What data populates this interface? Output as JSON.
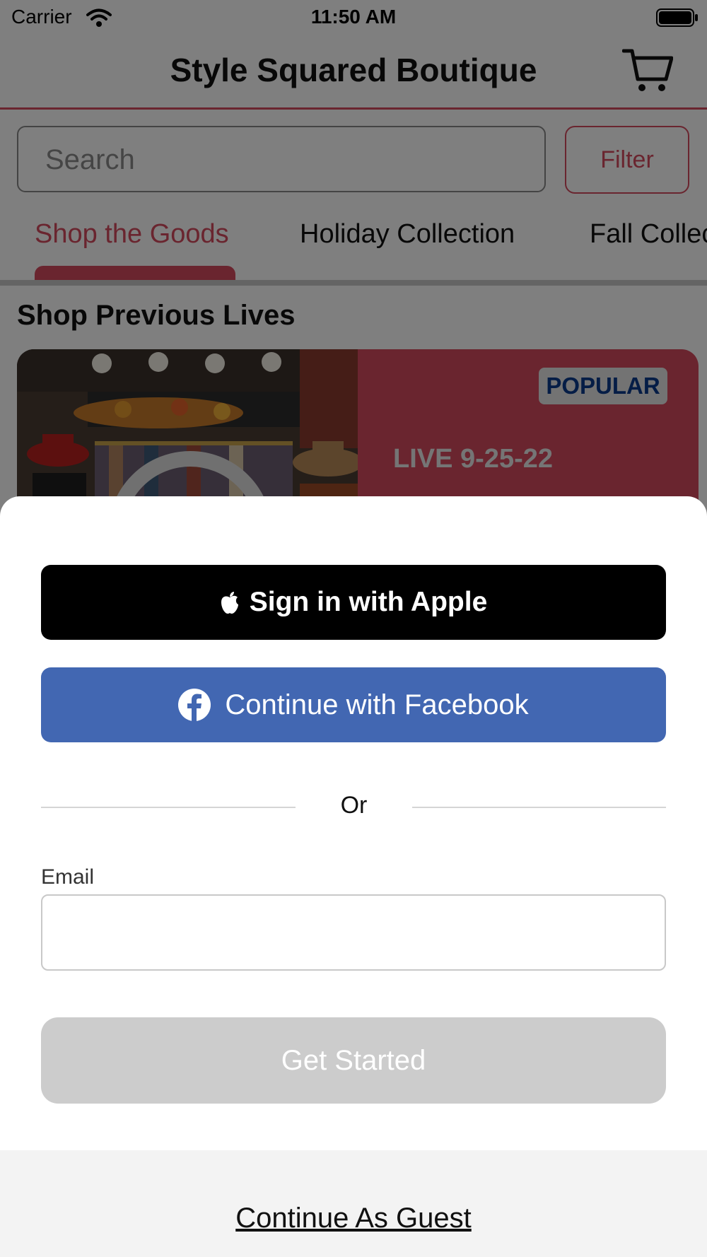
{
  "status_bar": {
    "carrier": "Carrier",
    "time": "11:50 AM",
    "icons": [
      "wifi-icon",
      "battery-icon"
    ]
  },
  "nav": {
    "title": "Style Squared Boutique",
    "cart_icon": "cart-icon"
  },
  "search": {
    "placeholder": "Search",
    "filter_label": "Filter"
  },
  "tabs": [
    {
      "label": "Shop the Goods",
      "active": true
    },
    {
      "label": "Holiday Collection",
      "active": false
    },
    {
      "label": "Fall Collec",
      "active": false
    }
  ],
  "section": {
    "title": "Shop Previous Lives"
  },
  "live_card": {
    "badge": "POPULAR",
    "title": "LIVE 9-25-22"
  },
  "sheet": {
    "apple_label": "Sign in with Apple",
    "facebook_label": "Continue with Facebook",
    "divider_text": "Or",
    "email_label": "Email",
    "email_value": "",
    "get_started_label": "Get Started",
    "guest_label": "Continue As Guest"
  },
  "colors": {
    "accent": "#d44a5e",
    "facebook": "#4267b2",
    "apple": "#000000",
    "disabled_button": "#cccccc",
    "badge_text": "#0a3b8c"
  }
}
